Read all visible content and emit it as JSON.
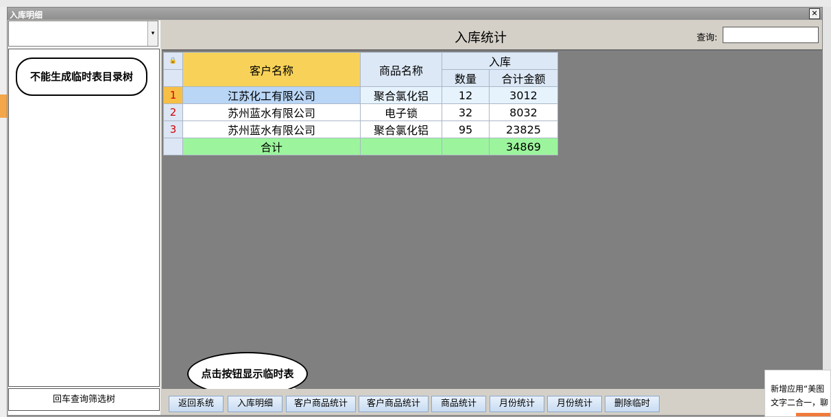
{
  "window": {
    "title": "入库明细",
    "close_glyph": "✕"
  },
  "left_panel": {
    "combo_value": "",
    "combo_arrow": "▾",
    "tree_note": "不能生成临时表目录树",
    "filter_button": "回车查询筛选树"
  },
  "header": {
    "title": "入库统计",
    "query_label": "查询:",
    "query_value": ""
  },
  "table": {
    "corner_icon": "lock-icon",
    "corner_glyph": "🔒",
    "columns": {
      "customer": "客户名称",
      "goods": "商品名称",
      "group": "入库",
      "qty": "数量",
      "amount": "合计金额"
    },
    "rows": [
      {
        "n": "1",
        "customer": "江苏化工有限公司",
        "goods": "聚合氯化铝",
        "qty": "12",
        "amount": "3012"
      },
      {
        "n": "2",
        "customer": "苏州蓝水有限公司",
        "goods": "电子锁",
        "qty": "32",
        "amount": "8032"
      },
      {
        "n": "3",
        "customer": "苏州蓝水有限公司",
        "goods": "聚合氯化铝",
        "qty": "95",
        "amount": "23825"
      }
    ],
    "total": {
      "label": "合计",
      "amount": "34869"
    }
  },
  "callout": "点击按钮显示临时表",
  "buttons": [
    "返回系统",
    "入库明细",
    "客户商品统计",
    "客户商品统计",
    "商品统计",
    "月份统计",
    "月份统计",
    "删除临时"
  ],
  "notification": {
    "line1": "新增应用“美图",
    "line2": "文字二合一，聊"
  },
  "colors": {
    "customer_header": "#f8d258",
    "selected_rownum": "#f7bf45",
    "total_row": "#9cf59c",
    "selected_cell": "#b9d6f6"
  }
}
